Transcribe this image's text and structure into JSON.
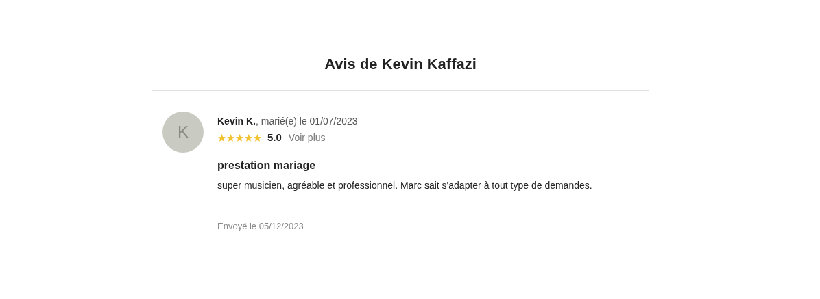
{
  "title": "Avis de Kevin Kaffazi",
  "review": {
    "avatar_letter": "K",
    "author": "Kevin K.",
    "married": ", marié(e) le 01/07/2023",
    "stars": 5,
    "score": "5.0",
    "more_link": "Voir plus",
    "heading": "prestation mariage",
    "body": "super musicien, agréable et professionnel. Marc sait s'adapter à tout type de demandes.",
    "sent": "Envoyé le 05/12/2023"
  }
}
